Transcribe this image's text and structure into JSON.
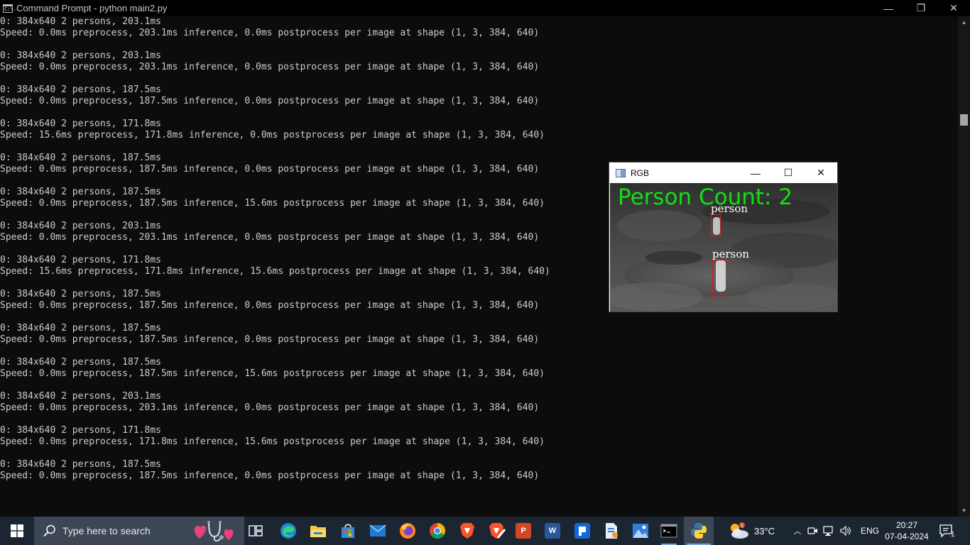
{
  "titlebar": {
    "icon_text": "C:\\.",
    "title": "Command Prompt - python  main2.py",
    "minimize_glyph": "—",
    "restore_glyph": "❐",
    "close_glyph": "✕"
  },
  "console": {
    "entries": [
      {
        "summary": "0: 384x640 2 persons, 203.1ms",
        "speed": "Speed: 0.0ms preprocess, 203.1ms inference, 0.0ms postprocess per image at shape (1, 3, 384, 640)"
      },
      {
        "summary": "0: 384x640 2 persons, 203.1ms",
        "speed": "Speed: 0.0ms preprocess, 203.1ms inference, 0.0ms postprocess per image at shape (1, 3, 384, 640)"
      },
      {
        "summary": "0: 384x640 2 persons, 187.5ms",
        "speed": "Speed: 0.0ms preprocess, 187.5ms inference, 0.0ms postprocess per image at shape (1, 3, 384, 640)"
      },
      {
        "summary": "0: 384x640 2 persons, 171.8ms",
        "speed": "Speed: 15.6ms preprocess, 171.8ms inference, 0.0ms postprocess per image at shape (1, 3, 384, 640)"
      },
      {
        "summary": "0: 384x640 2 persons, 187.5ms",
        "speed": "Speed: 0.0ms preprocess, 187.5ms inference, 0.0ms postprocess per image at shape (1, 3, 384, 640)"
      },
      {
        "summary": "0: 384x640 2 persons, 187.5ms",
        "speed": "Speed: 0.0ms preprocess, 187.5ms inference, 15.6ms postprocess per image at shape (1, 3, 384, 640)"
      },
      {
        "summary": "0: 384x640 2 persons, 203.1ms",
        "speed": "Speed: 0.0ms preprocess, 203.1ms inference, 0.0ms postprocess per image at shape (1, 3, 384, 640)"
      },
      {
        "summary": "0: 384x640 2 persons, 171.8ms",
        "speed": "Speed: 15.6ms preprocess, 171.8ms inference, 15.6ms postprocess per image at shape (1, 3, 384, 640)"
      },
      {
        "summary": "0: 384x640 2 persons, 187.5ms",
        "speed": "Speed: 0.0ms preprocess, 187.5ms inference, 0.0ms postprocess per image at shape (1, 3, 384, 640)"
      },
      {
        "summary": "0: 384x640 2 persons, 187.5ms",
        "speed": "Speed: 0.0ms preprocess, 187.5ms inference, 0.0ms postprocess per image at shape (1, 3, 384, 640)"
      },
      {
        "summary": "0: 384x640 2 persons, 187.5ms",
        "speed": "Speed: 0.0ms preprocess, 187.5ms inference, 15.6ms postprocess per image at shape (1, 3, 384, 640)"
      },
      {
        "summary": "0: 384x640 2 persons, 203.1ms",
        "speed": "Speed: 0.0ms preprocess, 203.1ms inference, 0.0ms postprocess per image at shape (1, 3, 384, 640)"
      },
      {
        "summary": "0: 384x640 2 persons, 171.8ms",
        "speed": "Speed: 0.0ms preprocess, 171.8ms inference, 15.6ms postprocess per image at shape (1, 3, 384, 640)"
      },
      {
        "summary": "0: 384x640 2 persons, 187.5ms",
        "speed": "Speed: 0.0ms preprocess, 187.5ms inference, 0.0ms postprocess per image at shape (1, 3, 384, 640)"
      }
    ]
  },
  "rgb_window": {
    "title": "RGB",
    "minimize_glyph": "—",
    "maximize_glyph": "☐",
    "close_glyph": "✕",
    "count_text": "Person Count: 2",
    "detections": [
      {
        "label": "person"
      },
      {
        "label": "person"
      }
    ],
    "colors": {
      "count_text": "#11e011",
      "box": "#d42020",
      "label": "#ffffff"
    }
  },
  "taskbar": {
    "search_placeholder": "Type here to search",
    "apps": [
      {
        "name": "task-view",
        "label": "Task View",
        "icon": "task-view-icon"
      },
      {
        "name": "edge",
        "label": "Microsoft Edge",
        "icon": "edge-icon"
      },
      {
        "name": "file-explorer",
        "label": "File Explorer",
        "icon": "folder-icon"
      },
      {
        "name": "store",
        "label": "Microsoft Store",
        "icon": "store-icon"
      },
      {
        "name": "mail",
        "label": "Mail",
        "icon": "mail-icon"
      },
      {
        "name": "firefox",
        "label": "Firefox",
        "icon": "firefox-icon"
      },
      {
        "name": "chrome",
        "label": "Chrome",
        "icon": "chrome-icon"
      },
      {
        "name": "brave",
        "label": "Brave",
        "icon": "brave-icon"
      },
      {
        "name": "brave-alt",
        "label": "Brave",
        "icon": "brave-icon"
      },
      {
        "name": "powerpoint",
        "label": "PowerPoint",
        "icon": "powerpoint-icon"
      },
      {
        "name": "word",
        "label": "Word",
        "icon": "word-icon"
      },
      {
        "name": "app-blue",
        "label": "App",
        "icon": "app-icon"
      },
      {
        "name": "file-viewer",
        "label": "File viewer",
        "icon": "document-icon"
      },
      {
        "name": "photos",
        "label": "Photos",
        "icon": "photos-icon"
      },
      {
        "name": "command-prompt",
        "label": "Command Prompt",
        "icon": "terminal-icon"
      },
      {
        "name": "python",
        "label": "Python",
        "icon": "python-icon"
      }
    ],
    "weather": {
      "temp": "33°C",
      "icon": "cloudy-sun-icon"
    },
    "language": "ENG",
    "time": "20:27",
    "date": "07-04-2024",
    "notification_count": "1"
  }
}
